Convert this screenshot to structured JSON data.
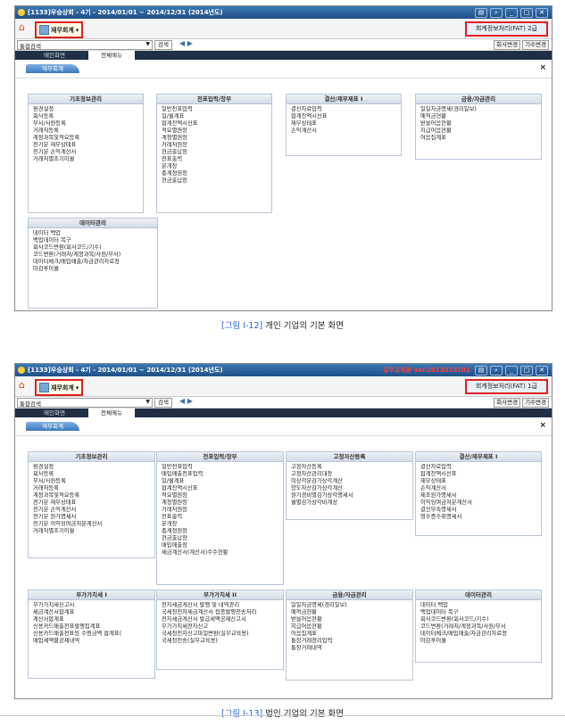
{
  "common": {
    "window_title": "[1133]우승상회 - 4기 - 2014/01/01 ~ 2014/12/31 (2014년도)",
    "window_buttons": [
      "▤",
      "⌕",
      "_",
      "□",
      "✕"
    ],
    "menu_button_label": "재무회계",
    "address_combo": "통합검색",
    "search_button": "검색",
    "nav_arrows": "◀ ▶",
    "right_buttons": [
      "회사변경",
      "기수변경"
    ],
    "tabs": [
      "메인화면",
      "전체메뉴"
    ],
    "ribbon_label": "재무회계",
    "close_label": "×"
  },
  "fig1": {
    "cert_label": "회계정보처리(FAT) 2급",
    "panels": [
      {
        "title": "기초정보관리",
        "items": [
          "환경설정",
          "회사등록",
          "부서/사원등록",
          "거래처등록",
          "계정과목및적요등록",
          "전기분 재무상태표",
          "전기분 손익계산서",
          "거래처별초기이월"
        ]
      },
      {
        "title": "전표입력/장부",
        "items": [
          "일반전표입력",
          "일/월계표",
          "합계잔액시산표",
          "적요별원장",
          "계정별원장",
          "거래처원장",
          "현금출납장",
          "전표출력",
          "분개장",
          "총계정원장",
          "현금출납장"
        ]
      },
      {
        "title": "결산/재무제표 I",
        "items": [
          "결산자료입력",
          "합계잔액시산표",
          "재무상태표",
          "손익계산서"
        ]
      },
      {
        "title": "금융/자금관리",
        "items": [
          "일일자금명세(경리일보)",
          "예적금현황",
          "받을어음현황",
          "지급어음현황",
          "어음집계표"
        ]
      },
      {
        "title": "데이터관리",
        "items": [
          "데이터 백업",
          "백업데이터 복구",
          "회사코드변환(회사코드/기수)",
          "코드변환(거래처/계정과목/사원/부서)",
          "데이터체크/매입매출/자금관리자료정",
          "마감후이월"
        ]
      }
    ],
    "caption_fig": "[그림 Ⅰ-12]",
    "caption_text": "개인 기업의 기본 화면"
  },
  "fig2": {
    "edu_label": "실무교육용  ver.2013010101",
    "cert_label": "회계정보처리(FAT) 1급",
    "panels": [
      {
        "title": "기초정보관리",
        "items": [
          "환경설정",
          "회사등록",
          "부서/사원등록",
          "거래처등록",
          "계정과목및적요등록",
          "전기분 재무상태표",
          "전기분 손익계산서",
          "전기분 원가명세서",
          "전기분 이익잉여금처분계산서",
          "거래처별초기이월"
        ]
      },
      {
        "title": "전표입력/장부",
        "items": [
          "일반전표입력",
          "매입매출전표입력",
          "일/월계표",
          "합계잔액시산표",
          "적요별원장",
          "계정별원장",
          "거래처원장",
          "전표출력",
          "분개장",
          "총계정원장",
          "현금출납장",
          "매입매출장",
          "세금계산서(계산서)수수현황"
        ]
      },
      {
        "title": "고정자산등록",
        "items": [
          "고정자산등록",
          "고정자산관리대장",
          "미상각분감가상각계산",
          "양도자산감가상각계산",
          "원가경비별감가상각명세서",
          "월별감가상각비계상"
        ]
      },
      {
        "title": "결산/재무제표 I",
        "items": [
          "결산자료입력",
          "합계잔액시산표",
          "재무상태표",
          "손익계산서",
          "제조원가명세서",
          "이익잉여금처분계산서",
          "결산부속명세서",
          "영수증수취명세서"
        ]
      },
      {
        "title": "부가가치세 I",
        "items": [
          "부가가치세신고서",
          "세금계산서합계표",
          "계산서합계표",
          "신용카드매출전표발행집계표",
          "신용카드매출전표등 수령금액 합계표(",
          "매입세액불공제내역"
        ]
      },
      {
        "title": "부가가치세 II",
        "items": [
          "전자세금계산서 발행 및 내역관리",
          "국세청전자세금계산서 접종발행전송처리",
          "전자세금계산서 발급세액공제신고서",
          "부가가치세전자신고",
          "국세청전자신고파일변환(실무교육용)",
          "국세청전송(실무교육용)"
        ]
      },
      {
        "title": "금융/자금관리",
        "items": [
          "일일자금명세(경리일보)",
          "예적금현황",
          "받을어음현황",
          "지급어음현황",
          "어음집계표",
          "통장거래정리입력",
          "통장거래내역"
        ]
      },
      {
        "title": "데이터관리",
        "items": [
          "데이터 백업",
          "백업데이터 복구",
          "회사코드변환(회사코드/기수)",
          "코드변환(거래처/계정과목/사원/부서",
          "데이터체크/매입매출/자금관리자료정",
          "마감후이월"
        ]
      }
    ],
    "caption_fig": "[그림 Ⅰ-13]",
    "caption_text": "법인 기업의 기본 화면"
  }
}
